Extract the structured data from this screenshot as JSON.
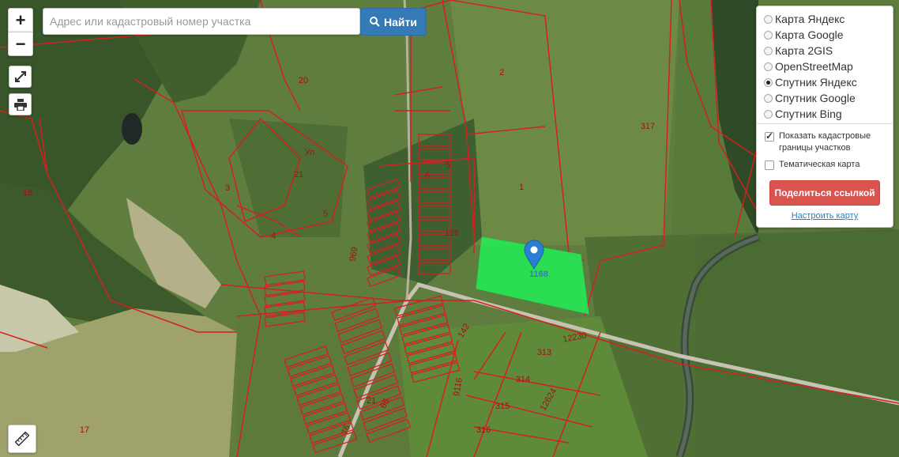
{
  "search": {
    "placeholder": "Адрес или кадастровый номер участка",
    "value": "",
    "button_label": "Найти"
  },
  "zoom": {
    "in_label": "+",
    "out_label": "−"
  },
  "layers": {
    "options": [
      {
        "label": "Карта Яндекс",
        "selected": false
      },
      {
        "label": "Карта Google",
        "selected": false
      },
      {
        "label": "Карта 2GIS",
        "selected": false
      },
      {
        "label": "OpenStreetMap",
        "selected": false
      },
      {
        "label": "Спутник Яндекс",
        "selected": true
      },
      {
        "label": "Спутник Google",
        "selected": false
      },
      {
        "label": "Спутник Bing",
        "selected": false
      }
    ],
    "show_boundaries": {
      "label": "Показать кадастровые границы участков",
      "checked": true
    },
    "thematic_map": {
      "label": "Тематическая карта",
      "checked": false
    },
    "share_label": "Поделиться ссылкой",
    "settings_link": "Настроить карту"
  },
  "map": {
    "selected_parcel_label": "1168",
    "selected_color": "#22ee55",
    "boundary_color": "#d42020",
    "marker_color": "#2a7fd4",
    "parcel_labels": [
      "20",
      "2",
      "317",
      "18",
      "3",
      "21",
      "5",
      "4",
      "6",
      "5",
      "1",
      "126",
      "969",
      "142",
      "12230",
      "313",
      "314",
      "9116",
      "315",
      "12624",
      "316",
      "21",
      "65",
      "76",
      "17",
      "Ул"
    ]
  }
}
